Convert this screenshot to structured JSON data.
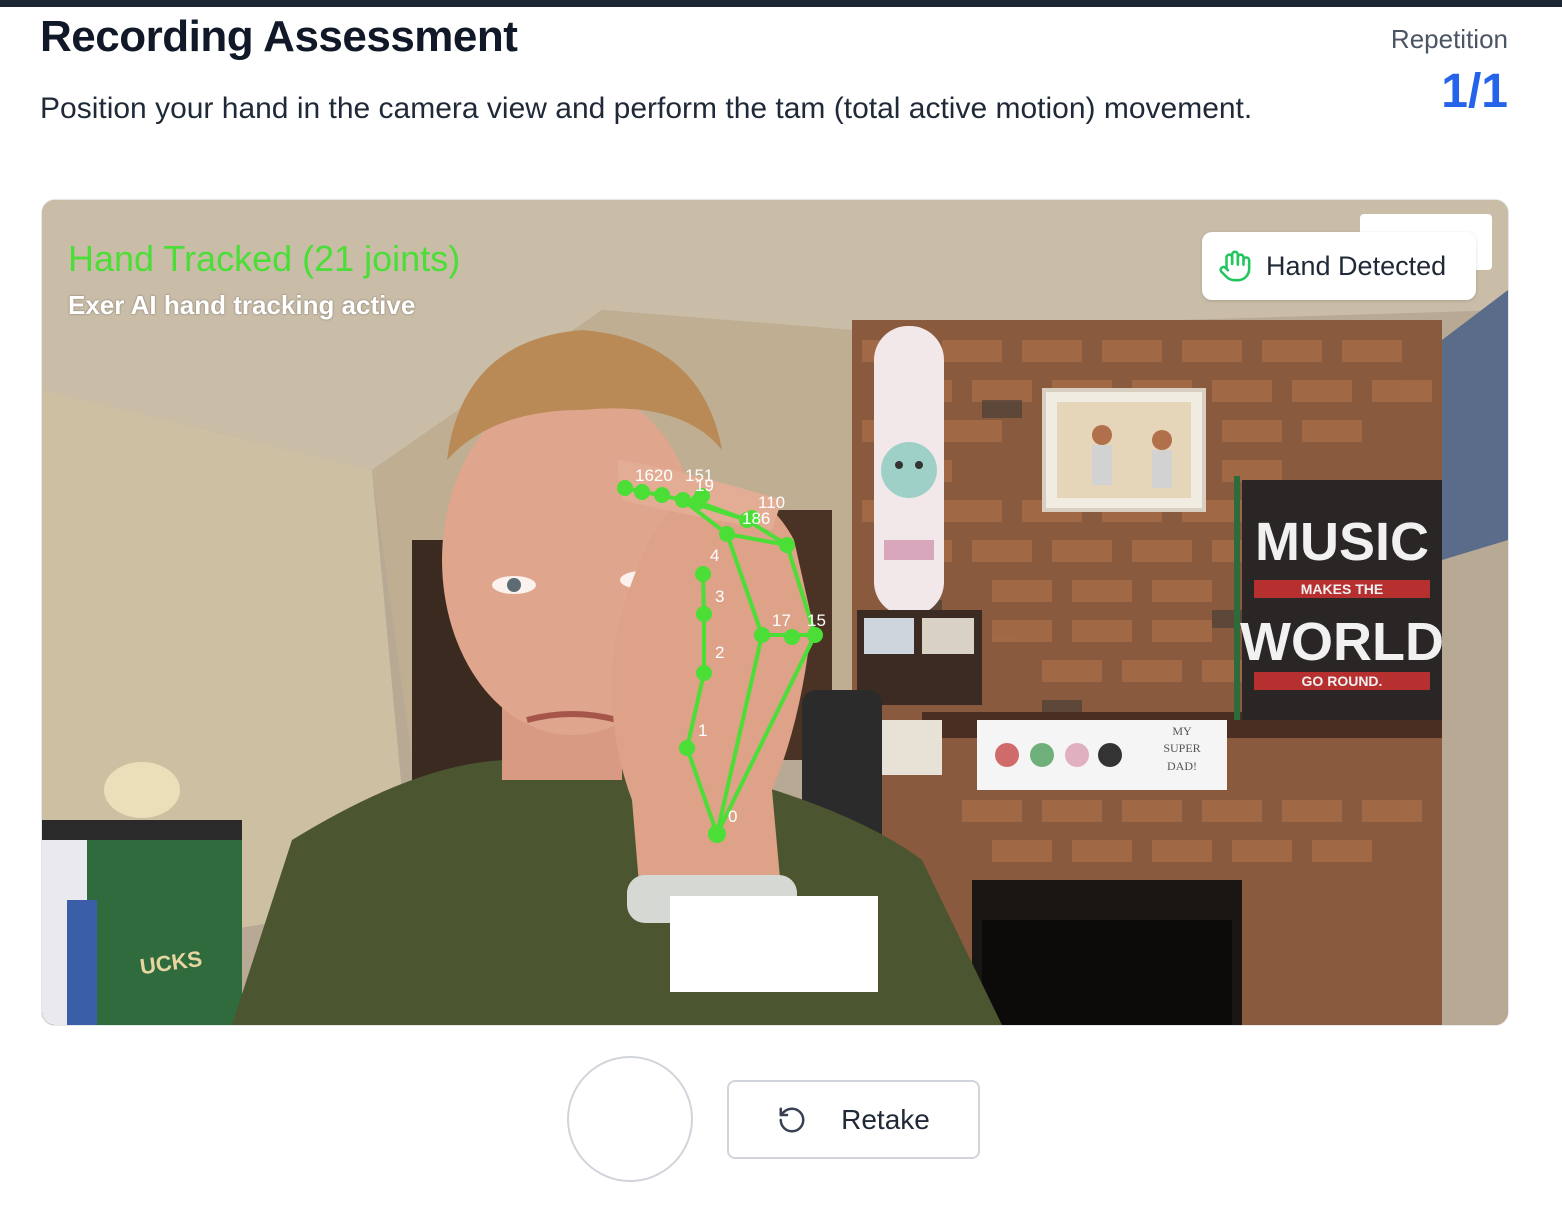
{
  "header": {
    "title": "Recording Assessment",
    "instructions": "Position your hand in the camera view and perform the tam (total active motion) movement."
  },
  "repetition": {
    "label": "Repetition",
    "value": "1/1"
  },
  "video": {
    "overlay_title": "Hand Tracked (21 joints)",
    "overlay_subtitle": "Exer AI hand tracking active",
    "status_badge": "Hand Detected",
    "status_icon": "hand-icon",
    "tracking_color": "#4ade36",
    "wall_art": {
      "music_poster": [
        "MUSIC",
        "MAKES THE",
        "WORLD",
        "GO ROUND."
      ],
      "sign": [
        "MY",
        "SUPER",
        "DAD!"
      ],
      "jersey_text": "UCKS"
    },
    "joint_labels": [
      "0",
      "1",
      "2",
      "3",
      "4",
      "17",
      "15",
      "110",
      "186",
      "1620",
      "151",
      "19"
    ]
  },
  "controls": {
    "record_button": "",
    "retake_label": "Retake",
    "retake_icon": "rotate-ccw-icon"
  },
  "colors": {
    "accent": "#2563eb",
    "tracking": "#4ade36",
    "top_bar": "#1e2533"
  }
}
